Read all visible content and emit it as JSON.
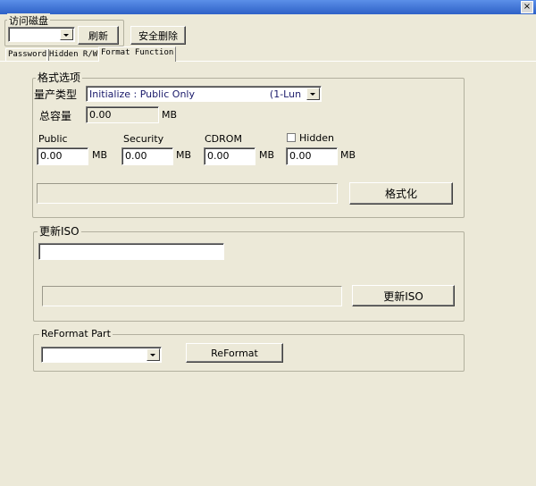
{
  "window": {
    "close_glyph": "×"
  },
  "disk": {
    "label": "访问磁盘",
    "selected": "",
    "refresh_label": "刷新",
    "safe_remove_label": "安全删除"
  },
  "tabs": [
    {
      "label": "Password"
    },
    {
      "label": "Hidden R/W"
    },
    {
      "label": "Format Function"
    }
  ],
  "format_options": {
    "title": "格式选项",
    "production_type_label": "量产类型",
    "production_type_value": "Initialize : Public Only                        (1-Lun  )",
    "total_capacity_label": "总容量",
    "total_capacity_value": "0.00",
    "unit": "MB",
    "public_label": "Public",
    "public_value": "0.00",
    "security_label": "Security",
    "security_value": "0.00",
    "cdrom_label": "CDROM",
    "cdrom_value": "0.00",
    "hidden_label": "Hidden",
    "hidden_checked": false,
    "hidden_value": "0.00",
    "format_button": "格式化"
  },
  "update_iso": {
    "title": "更新ISO",
    "path_value": "",
    "button": "更新ISO"
  },
  "reformat": {
    "title": "ReFormat Part",
    "selected": "",
    "button": "ReFormat"
  }
}
